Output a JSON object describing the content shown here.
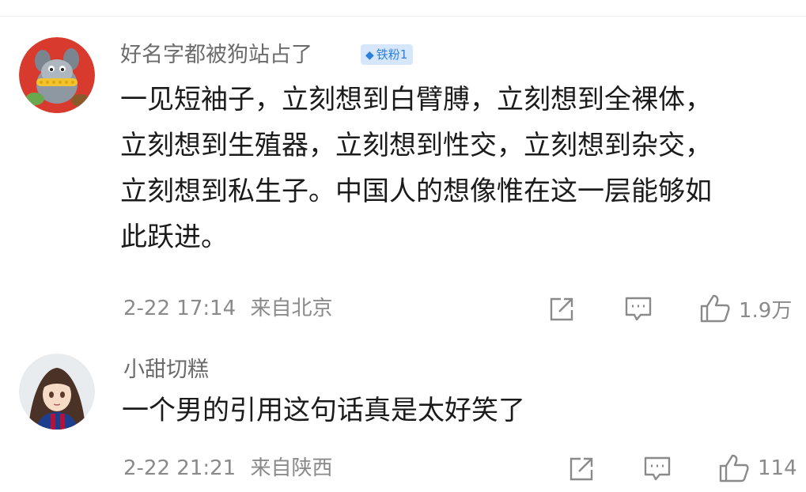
{
  "comments": [
    {
      "username": "好名字都被狗站占了",
      "badge": "铁粉1",
      "text_lines": [
        "一见短袖子，立刻想到白臂膊，立刻想到全裸体，",
        "立刻想到生殖器，立刻想到性交，立刻想到杂交，",
        "立刻想到私生子。中国人的想像惟在这一层能够如",
        "此跃进。"
      ],
      "timestamp": "2-22 17:14",
      "location": "来自北京",
      "likes": "1.9万",
      "avatar_icon": "cartoon-cat-avatar"
    },
    {
      "username": "小甜切糕",
      "text_lines": [
        "一个男的引用这句话真是太好笑了"
      ],
      "timestamp": "2-22 21:21",
      "location": "来自陕西",
      "likes": "114",
      "avatar_icon": "anime-girl-avatar"
    }
  ],
  "colors": {
    "badge_bg": "#d7e7fb",
    "badge_text": "#2b7fe0",
    "meta": "#8a8a8a",
    "username": "#6b6b6b"
  }
}
